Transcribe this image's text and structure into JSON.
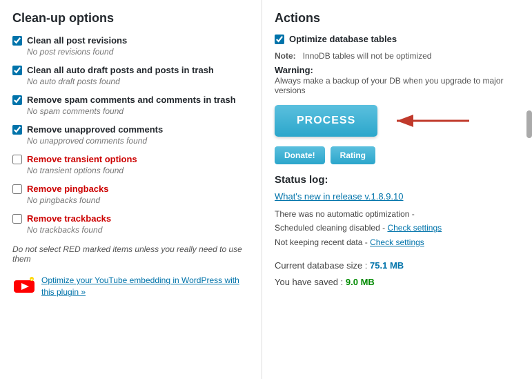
{
  "left": {
    "title": "Clean-up options",
    "options": [
      {
        "id": "opt1",
        "label": "Clean all post revisions",
        "sub": "No post revisions found",
        "checked": true,
        "red": false
      },
      {
        "id": "opt2",
        "label": "Clean all auto draft posts and posts in trash",
        "sub": "No auto draft posts found",
        "checked": true,
        "red": false
      },
      {
        "id": "opt3",
        "label": "Remove spam comments and comments in trash",
        "sub": "No spam comments found",
        "checked": true,
        "red": false
      },
      {
        "id": "opt4",
        "label": "Remove unapproved comments",
        "sub": "No unapproved comments found",
        "checked": true,
        "red": false
      },
      {
        "id": "opt5",
        "label": "Remove transient options",
        "sub": "No transient options found",
        "checked": false,
        "red": true
      },
      {
        "id": "opt6",
        "label": "Remove pingbacks",
        "sub": "No pingbacks found",
        "checked": false,
        "red": true
      },
      {
        "id": "opt7",
        "label": "Remove trackbacks",
        "sub": "No trackbacks found",
        "checked": false,
        "red": true
      }
    ],
    "warning": "Do not select RED marked items unless you really need to use them",
    "promo_text": "Optimize your YouTube embedding in WordPress with this plugin »"
  },
  "right": {
    "title": "Actions",
    "db_check_label": "Optimize database tables",
    "note_label": "Note:",
    "note_text": "InnoDB tables will not be optimized",
    "warning_label": "Warning:",
    "warning_text": "Always make a backup of your DB when you upgrade to major versions",
    "process_button": "PROCESS",
    "donate_button": "Donate!",
    "rating_button": "Rating",
    "status_log_title": "Status log:",
    "status_link": "What's new in release v.1.8.9.10",
    "status_line1": "There was no automatic optimization -",
    "status_line2": "Scheduled cleaning disabled - ",
    "status_link2": "Check settings",
    "status_line3": "Not keeping recent data - ",
    "status_link3": "Check settings",
    "db_size_label": "Current database size :",
    "db_size_value": "75.1 MB",
    "saved_label": "You have saved :",
    "saved_value": "9.0 MB"
  }
}
